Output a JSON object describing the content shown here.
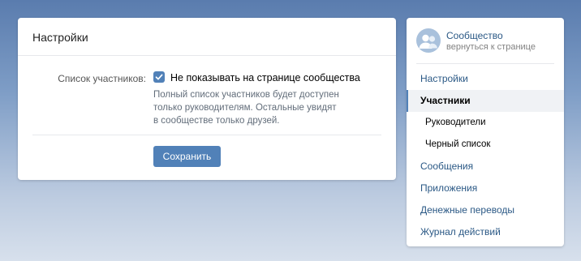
{
  "main": {
    "title": "Настройки",
    "setting": {
      "label": "Список участников:",
      "checkbox_checked": true,
      "checkbox_label": "Не показывать на странице сообщества",
      "hint_lines": [
        "Полный список участников будет доступен",
        "только руководителям. Остальные увидят",
        "в сообществе только друзей."
      ]
    },
    "save_label": "Сохранить"
  },
  "nav": {
    "community_name": "Сообщество",
    "community_back": "вернуться к странице",
    "items": [
      {
        "label": "Настройки",
        "type": "link"
      },
      {
        "label": "Участники",
        "type": "active"
      },
      {
        "label": "Руководители",
        "type": "sub"
      },
      {
        "label": "Черный список",
        "type": "sub"
      },
      {
        "label": "Сообщения",
        "type": "link"
      },
      {
        "label": "Приложения",
        "type": "link"
      },
      {
        "label": "Денежные переводы",
        "type": "link"
      },
      {
        "label": "Журнал действий",
        "type": "link"
      }
    ]
  },
  "colors": {
    "accent": "#5181b8",
    "link": "#2a5885"
  }
}
